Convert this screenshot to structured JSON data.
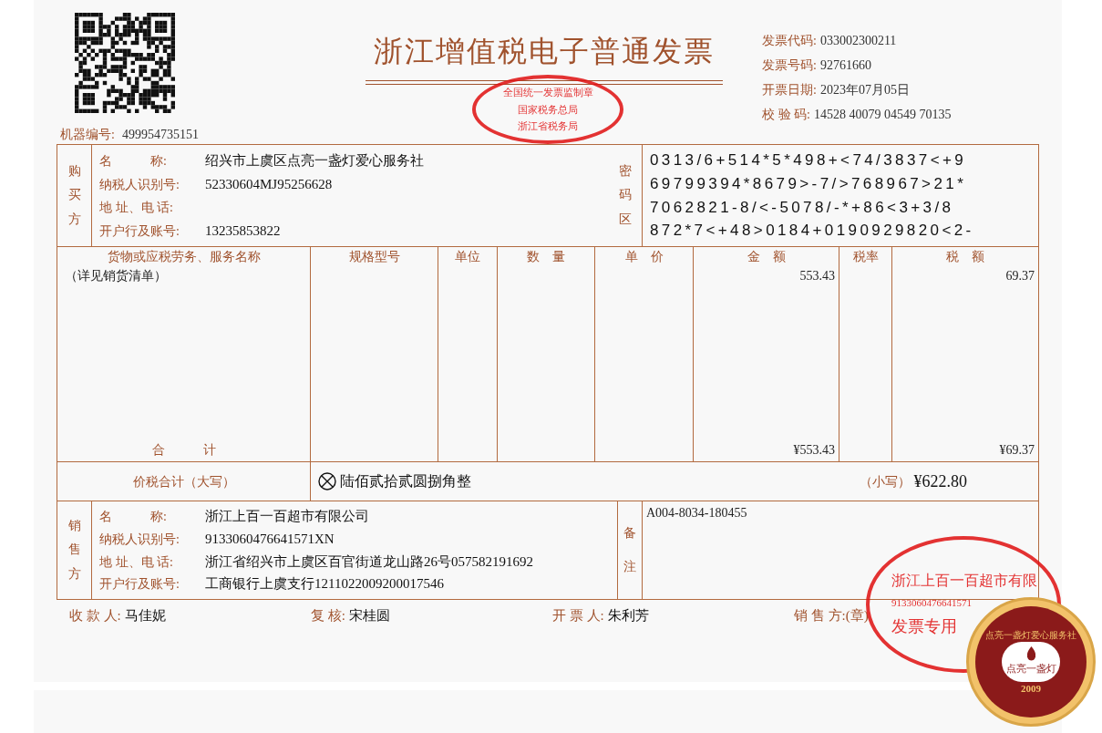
{
  "header": {
    "machine_no_label": "机器编号:",
    "machine_no": "499954735151",
    "title": "浙江增值税电子普通发票",
    "meta": [
      {
        "label": "发票代码:",
        "value": "033002300211"
      },
      {
        "label": "发票号码:",
        "value": "92761660"
      },
      {
        "label": "开票日期:",
        "value": "2023年07月05日"
      },
      {
        "label": "校 验 码:",
        "value": "14528 40079 04549 70135"
      }
    ]
  },
  "buyer": {
    "side_label": "购买方",
    "fields": [
      {
        "label": "名　　　称:",
        "value": "绍兴市上虞区点亮一盏灯爱心服务社"
      },
      {
        "label": "纳税人识别号:",
        "value": "52330604MJ95256628"
      },
      {
        "label": "地 址、电 话:"
      },
      {
        "label": "开户行及账号:",
        "value": "13235853822"
      }
    ]
  },
  "cipher": {
    "label": "密码区",
    "lines": [
      "0313/6+514*5*498+<74/3837<+9",
      "69799394*8679>-7/>768967>21*",
      "7062821-8/<-5078/-*+86<3+3/8",
      "872*7<+48>0184+0190929820<2-"
    ]
  },
  "items": {
    "columns": [
      "货物或应税劳务、服务名称",
      "规格型号",
      "单位",
      "数　量",
      "单　价",
      "金　额",
      "税率",
      "税　额"
    ],
    "rows": [
      [
        "（详见销货清单）",
        "",
        "",
        "",
        "",
        "553.43",
        "",
        "69.37"
      ]
    ],
    "total_label": "合　　　计",
    "total_amount": "¥553.43",
    "total_tax": "¥69.37"
  },
  "grand_total": {
    "label": "价税合计（大写）",
    "words": "陆佰贰拾贰圆捌角整",
    "small_label": "（小写）",
    "small_value": "¥622.80"
  },
  "seller": {
    "side_label": "销售方",
    "fields": [
      {
        "label": "名　　　称:",
        "value": "浙江上百一百超市有限公司"
      },
      {
        "label": "纳税人识别号:",
        "value": "9133060476641571XN"
      },
      {
        "label": "地 址、电 话:",
        "value": "浙江省绍兴市上虞区百官街道龙山路26号057582191692"
      },
      {
        "label": "开户行及账号:",
        "value": "工商银行上虞支行1211022009200017546"
      }
    ],
    "remarks_label": "备注",
    "remarks": "A004-8034-180455"
  },
  "footer": [
    {
      "label": "收 款 人:",
      "value": "马佳妮"
    },
    {
      "label": "复 核:",
      "value": "宋桂圆"
    },
    {
      "label": "开 票 人:",
      "value": "朱利芳"
    },
    {
      "label": "销 售 方:(章)"
    }
  ],
  "stamps": {
    "tax": [
      "全国统一发票监制章",
      "国家税务总局",
      "浙江省税务局"
    ],
    "seller": [
      "浙江上百一百超市有限",
      "9133060476641571",
      "发票专用"
    ],
    "logo": [
      "点亮一盏灯爱心服务社",
      "点亮一盏灯",
      "2009"
    ]
  }
}
